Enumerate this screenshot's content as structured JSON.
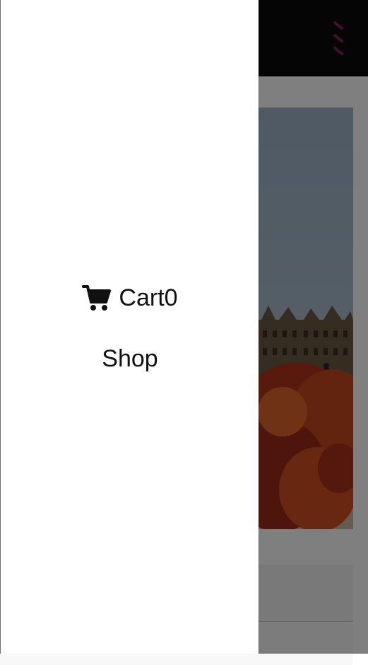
{
  "header": {
    "menu_icon": "menu-dots-icon",
    "accent_color": "#8b1d5a"
  },
  "drawer": {
    "cart": {
      "icon": "shopping-cart-icon",
      "label": "Cart",
      "count": "0"
    },
    "shop": {
      "label": "Shop"
    }
  }
}
